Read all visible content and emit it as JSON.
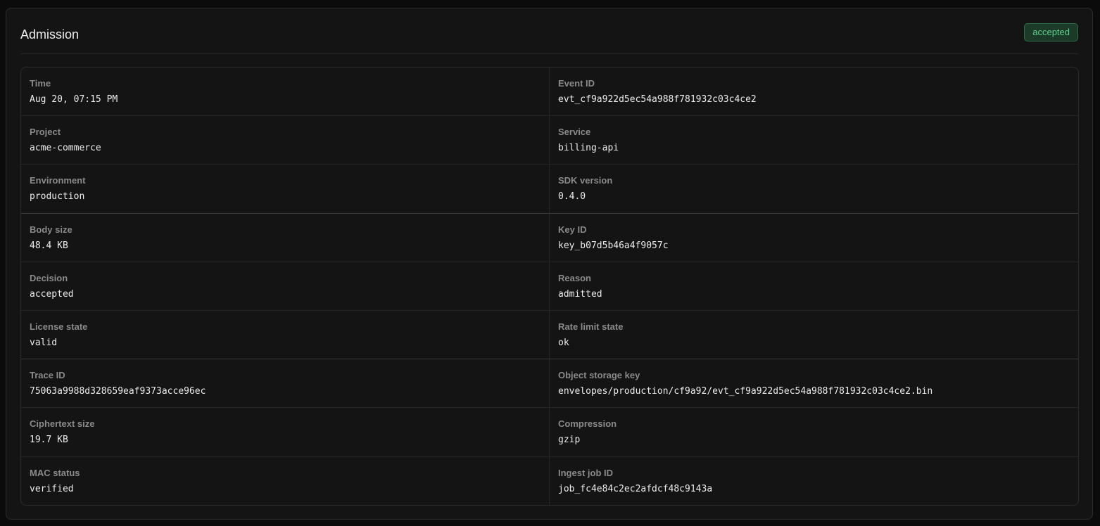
{
  "panel": {
    "title": "Admission",
    "status_badge": "accepted",
    "status_color": "#5fd08a"
  },
  "fields": [
    {
      "label": "Time",
      "value": "Aug 20, 07:15 PM"
    },
    {
      "label": "Event ID",
      "value": "evt_cf9a922d5ec54a988f781932c03c4ce2"
    },
    {
      "label": "Project",
      "value": "acme-commerce"
    },
    {
      "label": "Service",
      "value": "billing-api"
    },
    {
      "label": "Environment",
      "value": "production"
    },
    {
      "label": "SDK version",
      "value": "0.4.0"
    },
    {
      "label": "Body size",
      "value": "48.4 KB"
    },
    {
      "label": "Key ID",
      "value": "key_b07d5b46a4f9057c"
    },
    {
      "label": "Decision",
      "value": "accepted"
    },
    {
      "label": "Reason",
      "value": "admitted"
    },
    {
      "label": "License state",
      "value": "valid"
    },
    {
      "label": "Rate limit state",
      "value": "ok"
    },
    {
      "label": "Trace ID",
      "value": "75063a9988d328659eaf9373acce96ec"
    },
    {
      "label": "Object storage key",
      "value": "envelopes/production/cf9a92/evt_cf9a922d5ec54a988f781932c03c4ce2.bin"
    },
    {
      "label": "Ciphertext size",
      "value": "19.7 KB"
    },
    {
      "label": "Compression",
      "value": "gzip"
    },
    {
      "label": "MAC status",
      "value": "verified"
    },
    {
      "label": "Ingest job ID",
      "value": "job_fc4e84c2ec2afdcf48c9143a"
    }
  ]
}
